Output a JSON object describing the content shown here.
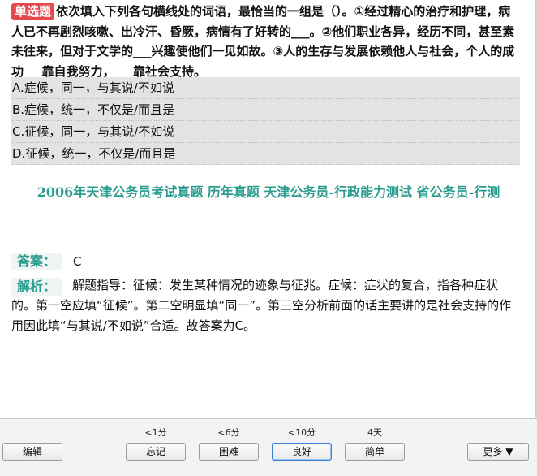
{
  "question": {
    "type_tag": "单选题",
    "text": "依次填入下列各句横线处的词语，最恰当的一组是（）。①经过精心的治疗和护理，病人已不再剧烈咳嗽、出冷汗、昏厥，病情有了好转的___。②他们职业各异，经历不同，甚至素未往来，但对于文学的___兴趣使他们一见如故。③人的生存与发展依赖他人与社会，个人的成功___靠自我努力，___靠社会支持。",
    "options": [
      "A.症候，同一，与其说/不如说",
      "B.症候，统一，不仅是/而且是",
      "C.征候，同一，与其说/不如说",
      "D.征候，统一，不仅是/而且是"
    ]
  },
  "source": "2006年天津公务员考试真题 历年真题 天津公务员-行政能力测试 省公务员-行测",
  "answer": {
    "label": "答案：",
    "value": "C"
  },
  "analysis": {
    "label": "解析：",
    "text": "解题指导：征候：发生某种情况的迹象与征兆。症候：症状的复合，指各种症状的。第一空应填“征候”。第二空明显填“同一”。第三空分析前面的话主要讲的是社会支持的作用因此填“与其说/不如说”合适。故答案为C。"
  },
  "toolbar": {
    "edit": "编辑",
    "more": "更多 ▼",
    "ratings": [
      {
        "hint": "<1分",
        "label": "忘记"
      },
      {
        "hint": "<6分",
        "label": "困难"
      },
      {
        "hint": "<10分",
        "label": "良好"
      },
      {
        "hint": "4天",
        "label": "简单"
      }
    ]
  }
}
